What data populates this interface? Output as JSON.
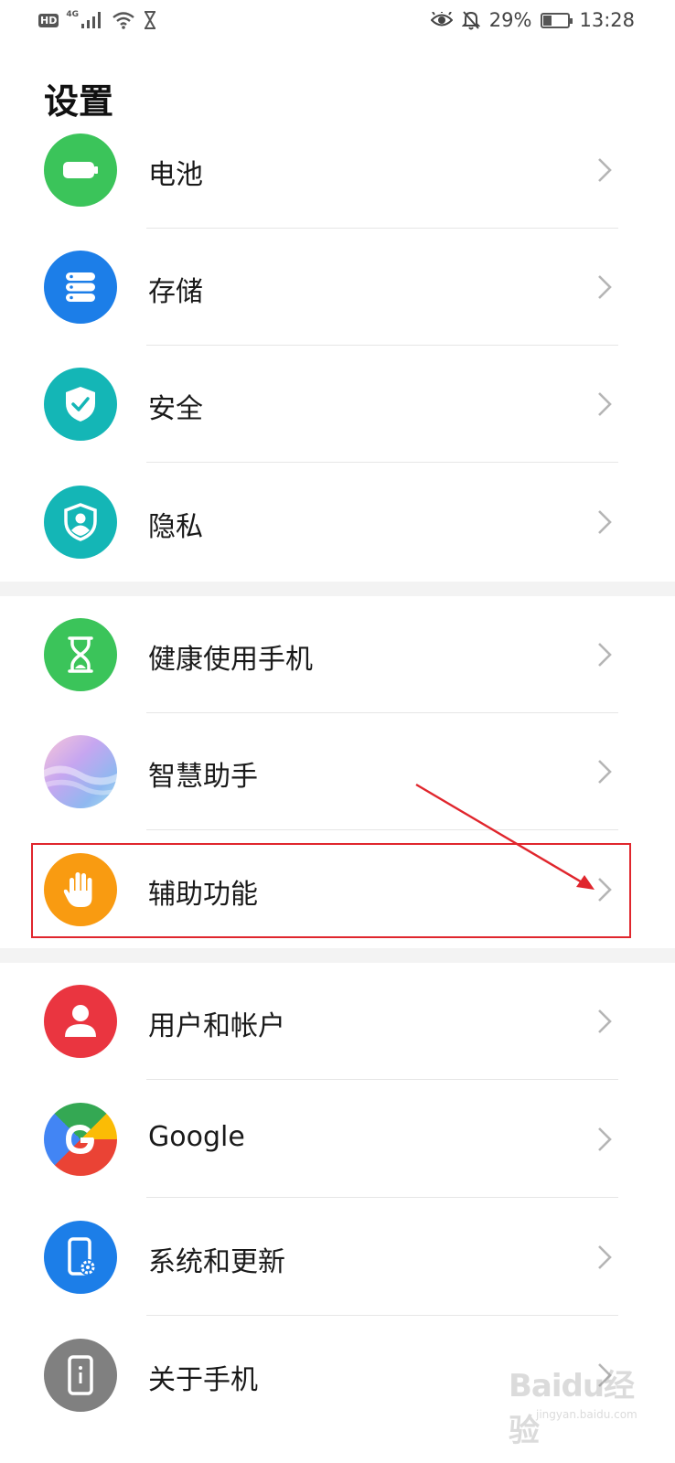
{
  "status_bar": {
    "hd": "HD",
    "network": "4G",
    "battery_text": "29%",
    "battery_level": 0.29,
    "time": "13:28"
  },
  "page_title": "设置",
  "rows": [
    {
      "label": "电池",
      "icon": "battery-icon",
      "color": "#3bc45a"
    },
    {
      "label": "存储",
      "icon": "storage-icon",
      "color": "#1c7ee8"
    },
    {
      "label": "安全",
      "icon": "security-shield-icon",
      "color": "#14b6b6"
    },
    {
      "label": "隐私",
      "icon": "privacy-icon",
      "color": "#14b6b6"
    },
    {
      "label": "健康使用手机",
      "icon": "hourglass-icon",
      "color": "#3bc45a"
    },
    {
      "label": "智慧助手",
      "icon": "assistant-icon",
      "color": "#b894f0"
    },
    {
      "label": "辅助功能",
      "icon": "hand-icon",
      "color": "#f99b11"
    },
    {
      "label": "用户和帐户",
      "icon": "user-icon",
      "color": "#ea3540"
    },
    {
      "label": "Google",
      "icon": "google-icon",
      "color": "#4285f4"
    },
    {
      "label": "系统和更新",
      "icon": "system-update-icon",
      "color": "#1c7ee8"
    },
    {
      "label": "关于手机",
      "icon": "phone-info-icon",
      "color": "#808080"
    }
  ],
  "annotation_color": "#e0262d",
  "watermark": {
    "main": "Baidu经验",
    "sub": "jingyan.baidu.com"
  }
}
